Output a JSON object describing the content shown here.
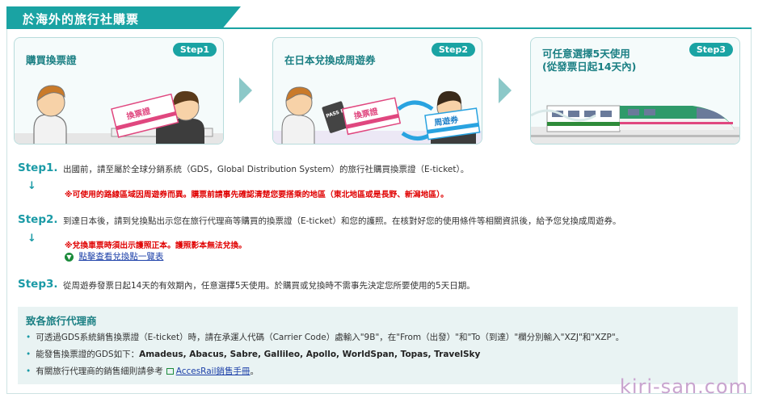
{
  "header": {
    "title": "於海外的旅行社購票"
  },
  "steps_cards": [
    {
      "badge": "Step1",
      "label": "購買換票證",
      "ticket": "換票證"
    },
    {
      "badge": "Step2",
      "label": "在日本兌換成周遊券",
      "ticket_a": "換票證",
      "ticket_b": "周遊券",
      "passport": "PASS PORT"
    },
    {
      "badge": "Step3",
      "label_line1": "可任意選擇5天使用",
      "label_line2": "(從發票日起14天內)"
    }
  ],
  "steps": [
    {
      "label": "Step1.",
      "text": "出國前，請至屬於全球分銷系統（GDS，Global Distribution System）的旅行社購買換票證（E-ticket）。",
      "warn": "※可使用的路線區域因周遊券而異。購票前請事先確認清楚您要搭乘的地區（東北地區或是長野、新潟地區）。"
    },
    {
      "label": "Step2.",
      "text": "到達日本後，請到兌換點出示您在旅行代理商等購買的換票證（E-ticket）和您的護照。在核對好您的使用條件等相關資訊後，給予您兌換成周遊券。",
      "warn": "※兌換車票時須出示護照正本。護照影本無法兌換。",
      "link": "點擊查看兌換點一覽表"
    },
    {
      "label": "Step3.",
      "text": "從周遊券發票日起14天的有效期內，任意選擇5天使用。於購買或兌換時不需事先決定您所要使用的5天日期。"
    }
  ],
  "agency": {
    "title": "致各旅行代理商",
    "item1": "可透過GDS系統銷售換票證（E-ticket）時，請在承運人代碼（Carrier Code）處輸入\"9B\"，在\"From（出發）\"和\"To（到達）\"欄分別輸入\"XZJ\"和\"XZP\"。",
    "item2_prefix": "能發售換票證的GDS如下：",
    "item2_bold": "Amadeus, Abacus, Sabre, Gallileo, Apollo, WorldSpan, Topas, TravelSky",
    "item3_prefix": "有關旅行代理商的銷售細則請參考",
    "item3_link": "AccesRail銷售手冊",
    "item3_suffix": "。"
  },
  "watermark": "kiri-san.com",
  "colors": {
    "accent": "#1aa3a3",
    "warn": "#e00000",
    "link": "#1b3fa8"
  }
}
